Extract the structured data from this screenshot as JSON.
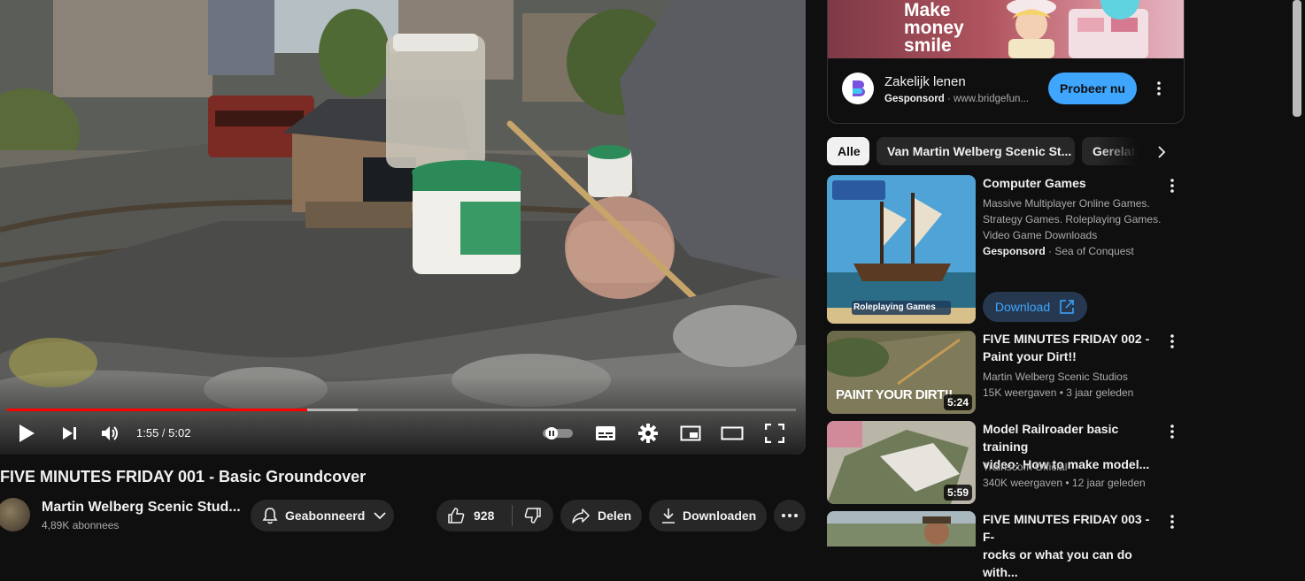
{
  "player": {
    "current_time": "1:55",
    "separator": " / ",
    "duration": "5:02",
    "played_fraction": 0.38,
    "buffered_fraction": 0.445
  },
  "video": {
    "title": "FIVE MINUTES FRIDAY 001 - Basic Groundcover",
    "channel_name": "Martin Welberg Scenic Stud...",
    "subscribers": "4,89K abonnees",
    "subscribe_label": "Geabonneerd",
    "likes": "928",
    "share_label": "Delen",
    "download_label": "Downloaden"
  },
  "ad": {
    "banner_text": [
      "Make",
      "money",
      "smile"
    ],
    "title": "Zakelijk lenen",
    "sponsored": "Gesponsord",
    "url": "www.bridgefun...",
    "cta": "Probeer nu"
  },
  "chips": [
    "Alle",
    "Van Martin Welberg Scenic St...",
    "Gerelate"
  ],
  "related": [
    {
      "title": "Computer Games",
      "description": [
        "Massive Multiplayer Online Games.",
        "Strategy Games. Roleplaying Games.",
        "Video Game Downloads"
      ],
      "sponsored": "Gesponsord",
      "advertiser": "Sea of Conquest",
      "thumb_text": "Roleplaying Games",
      "cta": "Download"
    },
    {
      "title_lines": [
        "FIVE MINUTES FRIDAY 002 -",
        "Paint your Dirt!!"
      ],
      "channel": "Martin Welberg Scenic Studios",
      "meta": "15K weergaven • 3 jaar geleden",
      "duration": "5:24",
      "thumb_text": "PAINT YOUR DIRT!!"
    },
    {
      "title_lines": [
        "Model Railroader basic training",
        "video: How to make model..."
      ],
      "channel": "Trainscom Official",
      "meta": "340K weergaven • 12 jaar geleden",
      "duration": "5:59"
    },
    {
      "title_lines": [
        "FIVE MINUTES FRIDAY 003 - F-",
        "rocks or what you can do with..."
      ]
    }
  ]
}
